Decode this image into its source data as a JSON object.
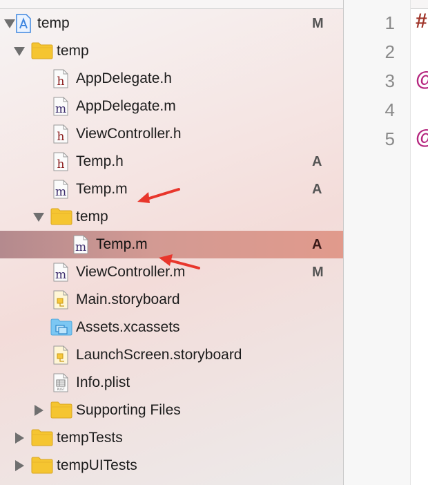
{
  "navigator": {
    "rows": [
      {
        "label": "temp",
        "badge": "M",
        "icon": "project-icon",
        "indent": 0,
        "disclosure": "down"
      },
      {
        "label": "temp",
        "badge": "",
        "icon": "folder-icon",
        "indent": 1,
        "disclosure": "down"
      },
      {
        "label": "AppDelegate.h",
        "badge": "",
        "icon": "header-file-icon",
        "indent": 2,
        "disclosure": ""
      },
      {
        "label": "AppDelegate.m",
        "badge": "",
        "icon": "m-file-icon",
        "indent": 2,
        "disclosure": ""
      },
      {
        "label": "ViewController.h",
        "badge": "",
        "icon": "header-file-icon",
        "indent": 2,
        "disclosure": ""
      },
      {
        "label": "Temp.h",
        "badge": "A",
        "icon": "header-file-icon",
        "indent": 2,
        "disclosure": ""
      },
      {
        "label": "Temp.m",
        "badge": "A",
        "icon": "m-file-icon",
        "indent": 2,
        "disclosure": ""
      },
      {
        "label": "temp",
        "badge": "",
        "icon": "folder-icon",
        "indent": 2,
        "disclosure": "down"
      },
      {
        "label": "Temp.m",
        "badge": "A",
        "icon": "m-file-icon",
        "indent": 3,
        "disclosure": "",
        "selected": true
      },
      {
        "label": "ViewController.m",
        "badge": "M",
        "icon": "m-file-icon",
        "indent": 2,
        "disclosure": ""
      },
      {
        "label": "Main.storyboard",
        "badge": "",
        "icon": "storyboard-icon",
        "indent": 2,
        "disclosure": ""
      },
      {
        "label": "Assets.xcassets",
        "badge": "",
        "icon": "assets-folder-icon",
        "indent": 2,
        "disclosure": ""
      },
      {
        "label": "LaunchScreen.storyboard",
        "badge": "",
        "icon": "storyboard-icon",
        "indent": 2,
        "disclosure": ""
      },
      {
        "label": "Info.plist",
        "badge": "",
        "icon": "plist-icon",
        "indent": 2,
        "disclosure": ""
      },
      {
        "label": "Supporting Files",
        "badge": "",
        "icon": "folder-icon",
        "indent": 2,
        "disclosure": "right"
      },
      {
        "label": "tempTests",
        "badge": "",
        "icon": "folder-icon",
        "indent": 1,
        "disclosure": "right"
      },
      {
        "label": "tempUITests",
        "badge": "",
        "icon": "folder-icon",
        "indent": 1,
        "disclosure": "right"
      }
    ]
  },
  "editor": {
    "line_numbers": [
      "1",
      "2",
      "3",
      "4",
      "5"
    ],
    "code_glyphs": [
      {
        "line": 1,
        "text": "#"
      },
      {
        "line": 3,
        "text": "@"
      },
      {
        "line": 5,
        "text": "@"
      }
    ]
  },
  "colors": {
    "badge": "#555555",
    "selection": "#d39a93",
    "folder": "#f5c531",
    "arrow": "#e8362c"
  }
}
